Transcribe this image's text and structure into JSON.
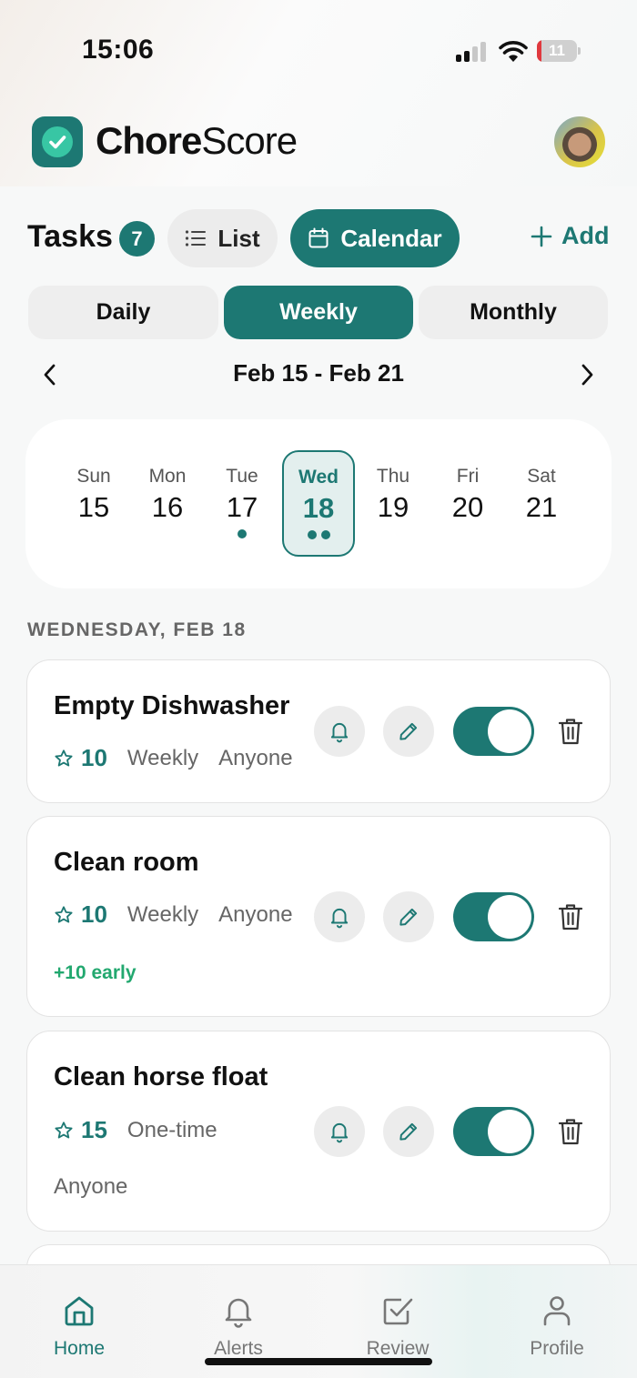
{
  "status_bar": {
    "time": "15:06",
    "battery": "11",
    "battery_level": 0.11
  },
  "header": {
    "brand_bold": "Chore",
    "brand_light": "Score"
  },
  "toolbar": {
    "title": "Tasks",
    "task_count": "7",
    "list_label": "List",
    "calendar_label": "Calendar",
    "add_label": "Add"
  },
  "periods": {
    "daily": "Daily",
    "weekly": "Weekly",
    "monthly": "Monthly",
    "selected": "Weekly"
  },
  "week": {
    "range": "Feb 15 - Feb 21",
    "days": [
      {
        "name": "Sun",
        "num": "15",
        "dots": 0
      },
      {
        "name": "Mon",
        "num": "16",
        "dots": 0
      },
      {
        "name": "Tue",
        "num": "17",
        "dots": 1
      },
      {
        "name": "Wed",
        "num": "18",
        "dots": 2,
        "selected": true
      },
      {
        "name": "Thu",
        "num": "19",
        "dots": 0
      },
      {
        "name": "Fri",
        "num": "20",
        "dots": 0
      },
      {
        "name": "Sat",
        "num": "21",
        "dots": 0
      }
    ]
  },
  "section_label": "WEDNESDAY, FEB 18",
  "tasks": [
    {
      "name": "Empty Dishwasher",
      "points": "10",
      "frequency": "Weekly",
      "assignee": "Anyone",
      "enabled": true
    },
    {
      "name": "Clean room",
      "points": "10",
      "frequency": "Weekly",
      "assignee": "Anyone",
      "bonus": "+10 early",
      "enabled": true
    },
    {
      "name": "Clean horse float",
      "points": "15",
      "frequency": "One-time",
      "assignee": "Anyone",
      "enabled": true
    }
  ],
  "tabbar": {
    "home": "Home",
    "alerts": "Alerts",
    "review": "Review",
    "profile": "Profile",
    "active": "Home"
  },
  "colors": {
    "accent": "#1d7873",
    "accent_light": "#38c6a4",
    "bonus": "#22a86f",
    "battery_low": "#e0393e"
  }
}
